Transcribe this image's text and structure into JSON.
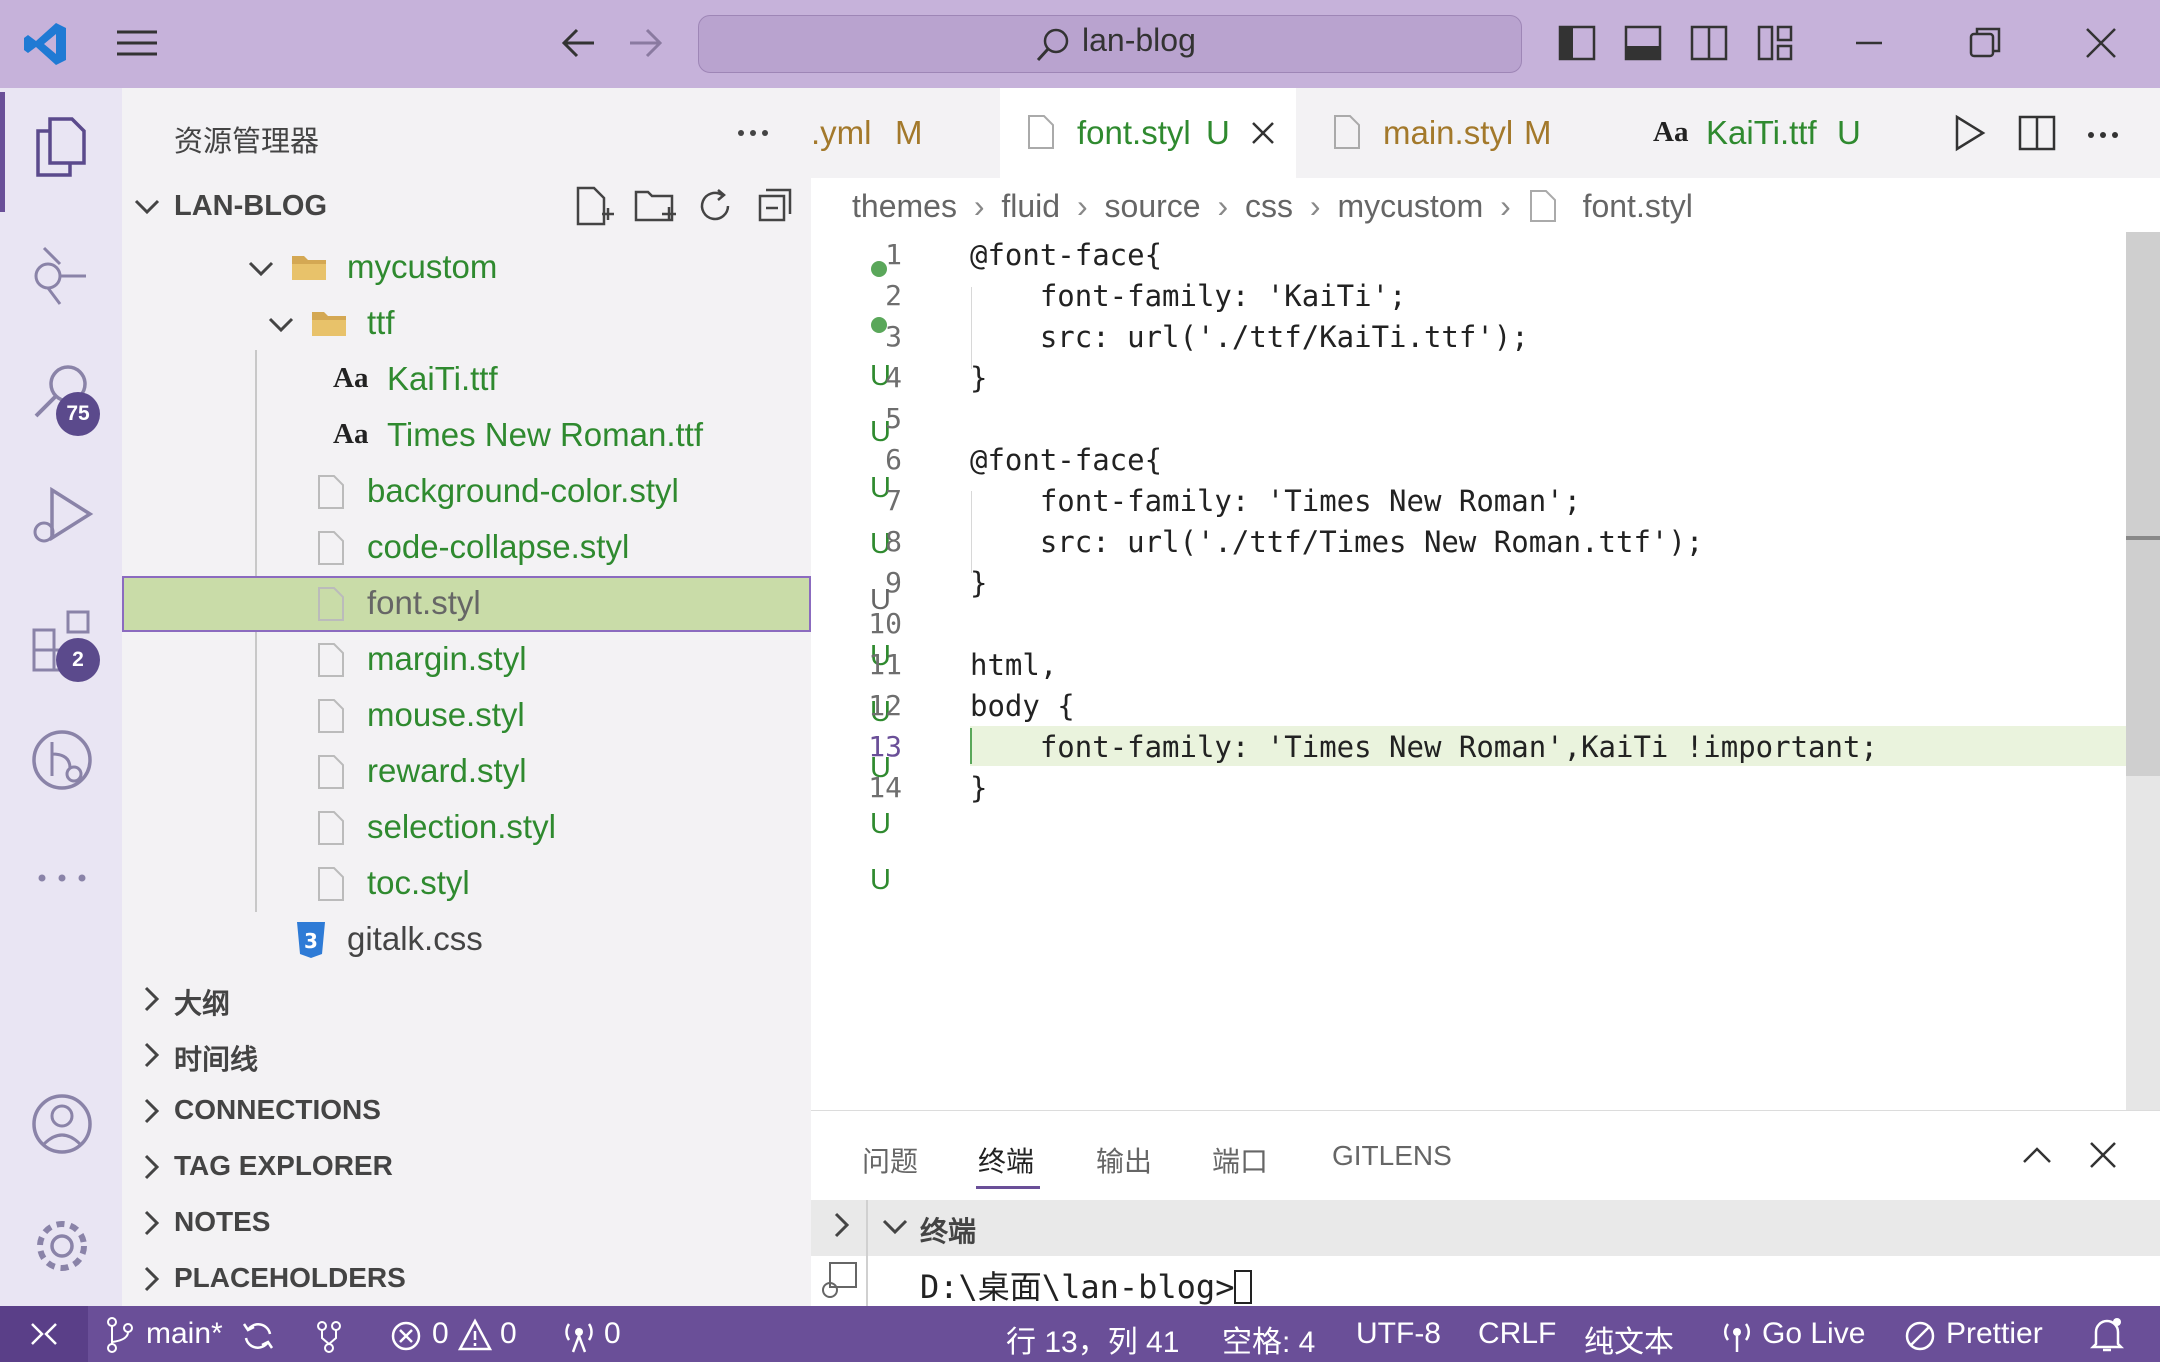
{
  "title_bar": {
    "search_text": "lan-blog"
  },
  "activity_bar": {
    "search_badge": "75",
    "extensions_badge": "2"
  },
  "explorer": {
    "title": "资源管理器",
    "root": "LAN-BLOG",
    "tree": [
      {
        "label": "mycustom",
        "status": "dot",
        "kind": "folder"
      },
      {
        "label": "ttf",
        "status": "dot",
        "kind": "folder"
      },
      {
        "label": "KaiTi.ttf",
        "status": "U",
        "kind": "font"
      },
      {
        "label": "Times New Roman.ttf",
        "status": "U",
        "kind": "font"
      },
      {
        "label": "background-color.styl",
        "status": "U",
        "kind": "file"
      },
      {
        "label": "code-collapse.styl",
        "status": "U",
        "kind": "file"
      },
      {
        "label": "font.styl",
        "status": "U",
        "kind": "file",
        "selected": true
      },
      {
        "label": "margin.styl",
        "status": "U",
        "kind": "file"
      },
      {
        "label": "mouse.styl",
        "status": "U",
        "kind": "file"
      },
      {
        "label": "reward.styl",
        "status": "U",
        "kind": "file"
      },
      {
        "label": "selection.styl",
        "status": "U",
        "kind": "file"
      },
      {
        "label": "toc.styl",
        "status": "U",
        "kind": "file"
      },
      {
        "label": "gitalk.css",
        "status": "",
        "kind": "css"
      }
    ],
    "sections": [
      "大纲",
      "时间线",
      "CONNECTIONS",
      "TAG EXPLORER",
      "NOTES",
      "PLACEHOLDERS"
    ]
  },
  "tabs": [
    {
      "label": ".yml",
      "status": "M"
    },
    {
      "label": "font.styl",
      "status": "U",
      "active": true
    },
    {
      "label": "main.styl",
      "status": "M"
    },
    {
      "label": "KaiTi.ttf",
      "status": "U"
    }
  ],
  "font_tab_icon": "Aa",
  "breadcrumb": [
    "themes",
    "fluid",
    "source",
    "css",
    "mycustom",
    "font.styl"
  ],
  "editor": {
    "current_line": 13,
    "lines": [
      "@font-face{",
      "    font-family: 'KaiTi';",
      "    src: url('./ttf/KaiTi.ttf');",
      "}",
      "",
      "@font-face{",
      "    font-family: 'Times New Roman';",
      "    src: url('./ttf/Times New Roman.ttf');",
      "}",
      "",
      "html,",
      "body {",
      "    font-family: 'Times New Roman',KaiTi !important;",
      "}"
    ]
  },
  "panel": {
    "tabs": [
      "问题",
      "终端",
      "输出",
      "端口",
      "GITLENS"
    ],
    "active_tab": "终端",
    "terminal_header": "终端",
    "prompt": "D:\\桌面\\lan-blog>"
  },
  "status_bar": {
    "branch": "main*",
    "errors": "0",
    "warnings": "0",
    "ports": "0",
    "position": "行 13，列 41",
    "spaces": "空格: 4",
    "encoding": "UTF-8",
    "eol": "CRLF",
    "language": "纯文本",
    "golive": "Go Live",
    "prettier": "Prettier"
  },
  "colors": {
    "title_bar": "#c6b2da",
    "status_bar": "#6a4f98",
    "git_untracked": "#2f8a2f",
    "git_modified": "#a3792b",
    "selection": "#c9dca8",
    "badge": "#5b4a8c"
  }
}
